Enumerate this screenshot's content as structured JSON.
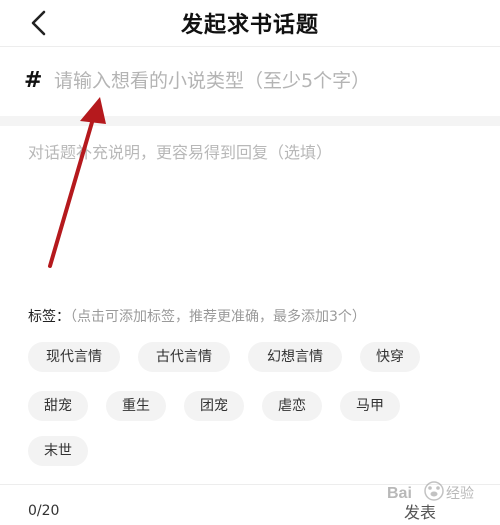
{
  "header": {
    "title": "发起求书话题",
    "back_icon": "chevron-left-icon"
  },
  "topic": {
    "hash_symbol": "#",
    "placeholder": "请输入想看的小说类型（至少5个字）",
    "value": ""
  },
  "description": {
    "placeholder": "对话题补充说明，更容易得到回复（选填）",
    "value": ""
  },
  "tags": {
    "label": "标签：",
    "hint": "（点击可添加标签，推荐更准确，最多添加3个）",
    "items": [
      "现代言情",
      "古代言情",
      "幻想言情",
      "快穿",
      "甜宠",
      "重生",
      "团宠",
      "虐恋",
      "马甲",
      "末世"
    ]
  },
  "footer": {
    "counter": "0/20",
    "publish_label": "发表"
  },
  "annotation": {
    "arrow_color": "#b5191d"
  },
  "watermark": {
    "text": "Bai 经验"
  }
}
